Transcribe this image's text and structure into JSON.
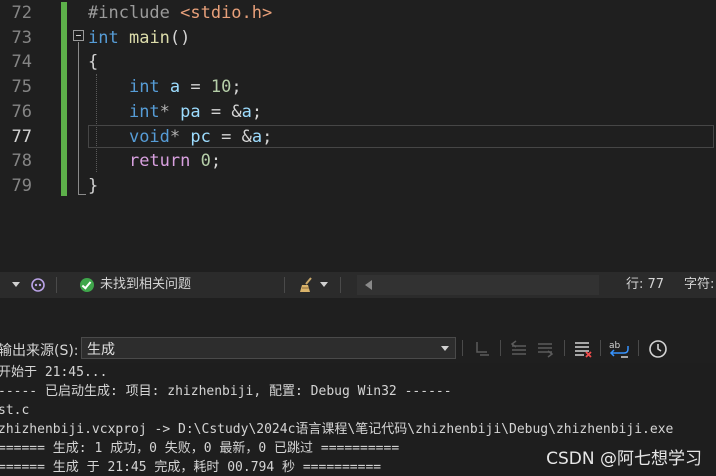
{
  "editor": {
    "line_numbers": [
      "72",
      "73",
      "74",
      "75",
      "76",
      "77",
      "78",
      "79"
    ],
    "lines": [
      [
        {
          "t": "#include ",
          "c": "pp"
        },
        {
          "t": "<stdio.h>",
          "c": "str"
        }
      ],
      [
        {
          "t": "int",
          "c": "kw"
        },
        {
          "t": " ",
          "c": ""
        },
        {
          "t": "main",
          "c": "fn"
        },
        {
          "t": "()",
          "c": ""
        }
      ],
      [
        {
          "t": "{",
          "c": ""
        }
      ],
      [
        {
          "t": "    ",
          "c": ""
        },
        {
          "t": "int",
          "c": "kw"
        },
        {
          "t": " ",
          "c": ""
        },
        {
          "t": "a",
          "c": "var"
        },
        {
          "t": " = ",
          "c": ""
        },
        {
          "t": "10",
          "c": "num"
        },
        {
          "t": ";",
          "c": ""
        }
      ],
      [
        {
          "t": "    ",
          "c": ""
        },
        {
          "t": "int",
          "c": "kw"
        },
        {
          "t": "* ",
          "c": "op"
        },
        {
          "t": "pa",
          "c": "var"
        },
        {
          "t": " = &",
          "c": ""
        },
        {
          "t": "a",
          "c": "var"
        },
        {
          "t": ";",
          "c": ""
        }
      ],
      [
        {
          "t": "    ",
          "c": ""
        },
        {
          "t": "void",
          "c": "kw"
        },
        {
          "t": "* ",
          "c": "op"
        },
        {
          "t": "pc",
          "c": "var"
        },
        {
          "t": " = &",
          "c": ""
        },
        {
          "t": "a",
          "c": "var"
        },
        {
          "t": ";",
          "c": ""
        }
      ],
      [
        {
          "t": "    ",
          "c": ""
        },
        {
          "t": "return",
          "c": "ctl"
        },
        {
          "t": " ",
          "c": ""
        },
        {
          "t": "0",
          "c": "num"
        },
        {
          "t": ";",
          "c": ""
        }
      ],
      [
        {
          "t": "}",
          "c": ""
        }
      ]
    ],
    "active_line": "77"
  },
  "status": {
    "issues_text": "未找到相关问题",
    "line_label": "行: 77",
    "char_label": "字符:"
  },
  "output": {
    "source_label": "输出来源(S):",
    "source_value": "生成",
    "lines": [
      "开始于 21:45...",
      "----- 已启动生成: 项目: zhizhenbiji, 配置: Debug Win32 ------",
      "st.c",
      "zhizhenbiji.vcxproj -> D:\\Cstudy\\2024c语言课程\\笔记代码\\zhizhenbiji\\Debug\\zhizhenbiji.exe",
      "====== 生成: 1 成功，0 失败，0 最新，0 已跳过 ==========",
      "====== 生成 于 21:45 完成，耗时 00.794 秒 =========="
    ]
  },
  "watermark": "CSDN @阿七想学习",
  "colors": {
    "background": "#1f1f1f",
    "keyword": "#569cd6",
    "string": "#e8a07a",
    "number": "#b5cea8",
    "control": "#d8a0df",
    "change_bar": "#5db04a"
  }
}
